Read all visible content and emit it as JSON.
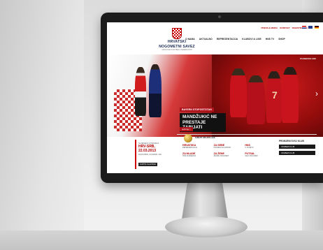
{
  "site": {
    "top_links": [
      "PRESS & MEDIA",
      "KONTAKT",
      "REGISTRACIJA"
    ],
    "logo": {
      "title_line1": "HRVATSKI",
      "title_line2": "NOGOMETNI SAVEZ",
      "subtitle": "CROATIAN FOOTBALL FEDERATION"
    },
    "nav": [
      "O NAMA",
      "AKTUALNO",
      "REPREZENTACIJA",
      "KLUBOVI & LIGE",
      "HNS TV",
      "SHOP"
    ]
  },
  "hero": {
    "tag": "BAYERN STOPOSTOTAN",
    "headline": "MANDŽUKIĆ NE PRESTAJE ZABIJATI",
    "more": "opširnije >",
    "social": "FACEBOOK LIKE",
    "jersey_number": "7"
  },
  "match": {
    "label": "SLJEDEĆA UTAKMICA",
    "title": "HRV-SRB, 22.03.2013",
    "venue": "MAKSIMIR, ZAGREB, 20h",
    "button": "KUPITE ULAZNICE"
  },
  "selections": {
    "title": "IZBOR SELEKCIJA",
    "items": [
      {
        "title": "HRVATSKA",
        "sub": "REPREZENTACIJA"
      },
      {
        "title": "ZA SEBE",
        "sub": "POKRENI SA SOBOM"
      },
      {
        "title": "HNS",
        "sub": "U SVIJETU"
      },
      {
        "title": "ZA MLADE",
        "sub": "HNS AKADEMIJA"
      },
      {
        "title": "ZA ŽENE",
        "sub": "ŽENSKI NOGOMET"
      },
      {
        "title": "FUTSAL",
        "sub": "MALI NOGOMET"
      }
    ]
  },
  "promo": {
    "title": "PROMJENI SVOJ KLUB",
    "buttons": [
      "ODABERI KLUB",
      "ODABERI KLUB"
    ]
  },
  "colors": {
    "brand_red": "#b10000",
    "navy": "#1a2a52"
  },
  "icons": [
    "arrow-left-icon",
    "arrow-right-icon",
    "crest-icon",
    "ball-icon"
  ]
}
